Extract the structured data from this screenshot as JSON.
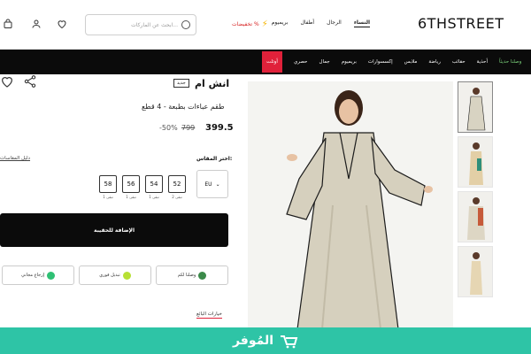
{
  "header": {
    "logo": "6THSTREET",
    "nav": [
      "النساء",
      "الرجال",
      "أطفال",
      "بريميوم"
    ],
    "sale": "تخفيضات %",
    "search_placeholder": "ابحث عن الماركات...",
    "icons": [
      "heart-icon",
      "user-icon",
      "bag-icon"
    ]
  },
  "categories": [
    "وصلنا حديثاً",
    "أحذية",
    "حقائب",
    "رياضة",
    "ملابس",
    "إكسسوارات",
    "بريميوم",
    "جمال",
    "حصري",
    "أوتلت"
  ],
  "product": {
    "brand": "انش ام",
    "badge": "جديد",
    "title": "طقم عباءات بطبعة - 4 قطع",
    "price": "399.5",
    "old_price": "799",
    "discount": "-50%"
  },
  "sizes": {
    "label": "اختر المقاس:",
    "guide": "دليل المقاسات",
    "unit": "EU",
    "options": [
      {
        "value": "52",
        "stock": "تبقى 2"
      },
      {
        "value": "54",
        "stock": "تبقى 1"
      },
      {
        "value": "56",
        "stock": "تبقى 1"
      },
      {
        "value": "58",
        "stock": "تبقى 1"
      }
    ]
  },
  "add_to_bag": "الإضافة للحقيبة",
  "features": [
    "وصلنا لكم",
    "تبديل فوري",
    "إرجاع مجاني"
  ],
  "seller_tab": "خيارات البائع",
  "watermark": "المُوفر",
  "colors": {
    "accent": "#e0213a",
    "bar": "#0b0b0b",
    "watermark": "#2ec4a6"
  }
}
